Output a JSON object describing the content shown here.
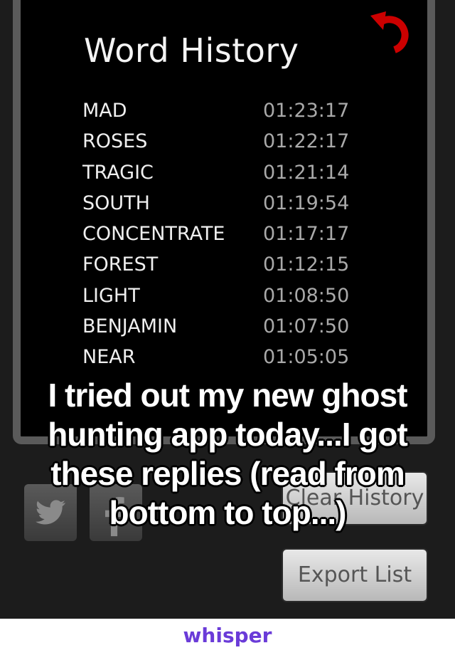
{
  "app": {
    "title": "Word History",
    "undo_icon": "undo-arrow-icon",
    "colors": {
      "accent": "#cc0000",
      "background": "#000000",
      "word_text": "#efefef",
      "time_text": "#a9a9a9"
    }
  },
  "history": [
    {
      "word": "MAD",
      "time": "01:23:17"
    },
    {
      "word": "ROSES",
      "time": "01:22:17"
    },
    {
      "word": "TRAGIC",
      "time": "01:21:14"
    },
    {
      "word": "SOUTH",
      "time": "01:19:54"
    },
    {
      "word": "CONCENTRATE",
      "time": "01:17:17"
    },
    {
      "word": "FOREST",
      "time": "01:12:15"
    },
    {
      "word": "LIGHT",
      "time": "01:08:50"
    },
    {
      "word": "BENJAMIN",
      "time": "01:07:50"
    },
    {
      "word": "NEAR",
      "time": "01:05:05"
    }
  ],
  "buttons": {
    "twitter_icon": "twitter-bird-icon",
    "facebook_icon": "facebook-f-icon",
    "clear_history": "Clear History",
    "export_list": "Export List"
  },
  "caption": {
    "lines": [
      "I tried out my new ghost",
      "hunting app today...I got",
      "these replies (read from",
      "bottom to top...)"
    ]
  },
  "footer": {
    "brand": "whisper",
    "brand_color": "#6a3bd8"
  }
}
